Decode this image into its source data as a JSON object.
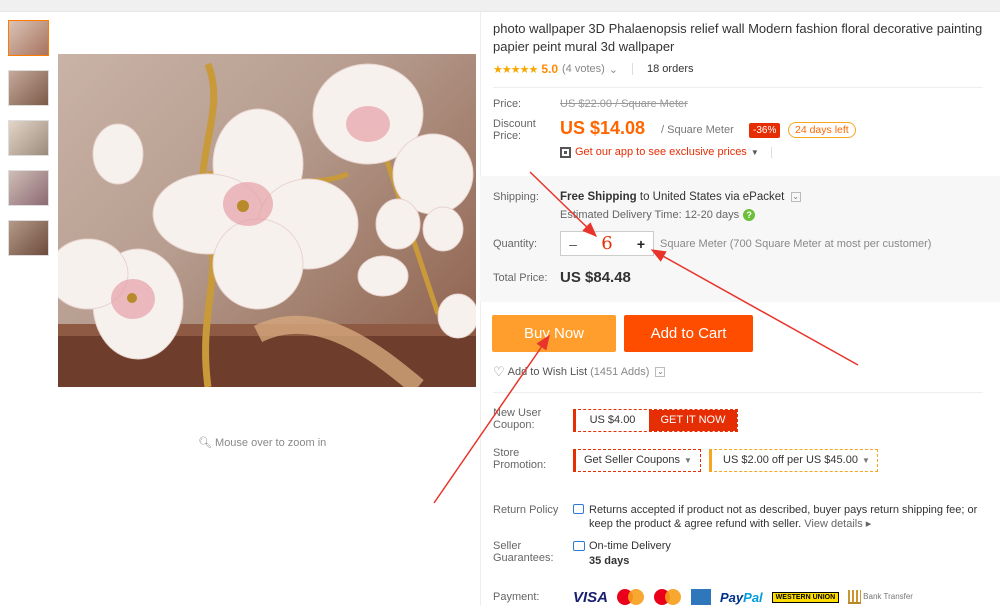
{
  "product": {
    "title": "photo wallpaper 3D Phalaenopsis relief wall Modern fashion floral decorative painting papier peint mural 3d wallpaper",
    "stars": "★★★★★",
    "rating": "5.0",
    "votes": "(4 votes)",
    "orders": "18 orders",
    "zoom_hint": "Mouse over to zoom in"
  },
  "price": {
    "price_label": "Price:",
    "original": "US $22.00 / Square Meter",
    "discount_label": "Discount Price:",
    "current": "US $14.08",
    "unit": "/ Square Meter",
    "discount_badge": "-36%",
    "days_left": "24 days left",
    "app_promo": "Get our app to see exclusive prices"
  },
  "shipping": {
    "label": "Shipping:",
    "free_text": "Free Shipping",
    "to_text": "to United States via ePacket",
    "estimated": "Estimated Delivery Time: 12-20 days"
  },
  "quantity": {
    "label": "Quantity:",
    "minus": "–",
    "value": "6",
    "plus": "+",
    "note": "Square Meter (700 Square Meter at most per customer)"
  },
  "total": {
    "label": "Total Price:",
    "value": "US $84.48"
  },
  "actions": {
    "buy_now": "Buy Now",
    "add_to_cart": "Add to Cart",
    "wish_list": "Add to Wish List",
    "wish_count": "(1451 Adds)"
  },
  "coupons": {
    "new_user_label": "New User Coupon:",
    "coupon_amount": "US $4.00",
    "get_it_now": "GET IT NOW",
    "store_promo_label": "Store Promotion:",
    "seller_coupons": "Get Seller Coupons",
    "promo_deal": "US $2.00 off per US $45.00"
  },
  "policy": {
    "return_label": "Return Policy",
    "return_text": "Returns accepted if product not as described, buyer pays return shipping fee; or keep the product & agree refund with seller.",
    "view_details": "View details ▸",
    "guarantee_label": "Seller Guarantees:",
    "guarantee_1": "On-time Delivery",
    "guarantee_2": "35 days"
  },
  "payment": {
    "label": "Payment:",
    "visa": "VISA",
    "paypal_1": "Pay",
    "paypal_2": "Pal",
    "wu": "WESTERN UNION",
    "bank": "Bank Transfer"
  },
  "colors": {
    "accent_orange": "#ff9e2c",
    "cart_orange": "#ff4d00",
    "price_red": "#f60",
    "annotation_red": "#e8342a"
  }
}
